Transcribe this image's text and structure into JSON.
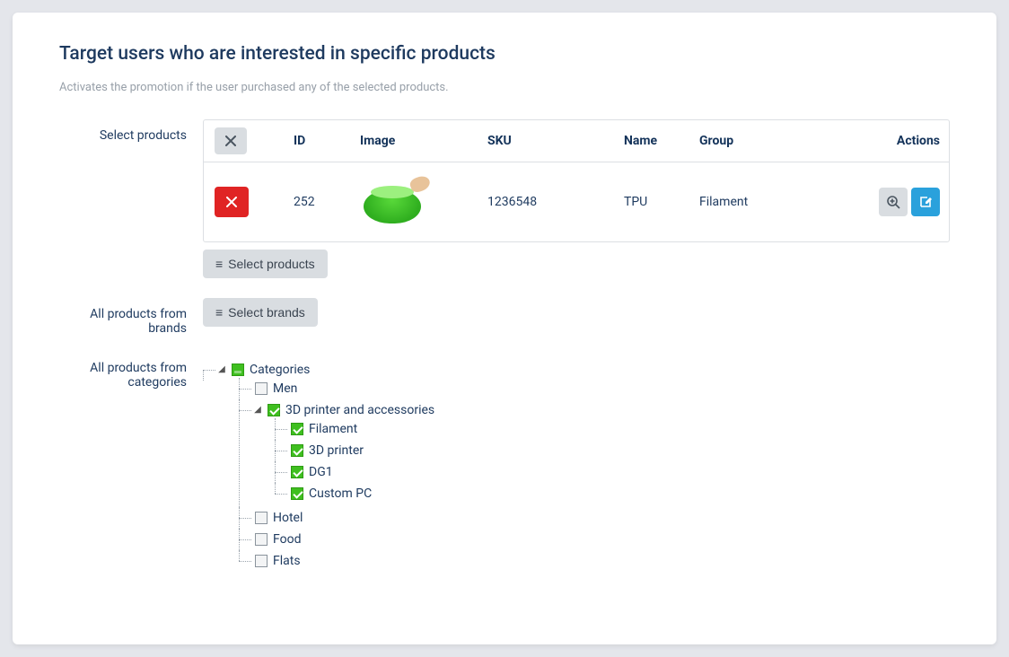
{
  "heading": "Target users who are interested in specific products",
  "subtitle": "Activates the promotion if the user purchased any of the selected products.",
  "labels": {
    "select_products": "Select products",
    "brands": "All products from brands",
    "categories": "All products from categories"
  },
  "table": {
    "headers": {
      "id": "ID",
      "image": "Image",
      "sku": "SKU",
      "name": "Name",
      "group": "Group",
      "actions": "Actions"
    },
    "rows": [
      {
        "id": "252",
        "sku": "1236548",
        "name": "TPU",
        "group": "Filament"
      }
    ]
  },
  "buttons": {
    "select_products": "Select products",
    "select_brands": "Select brands"
  },
  "tree": {
    "root": "Categories",
    "nodes": {
      "men": "Men",
      "printer": "3D printer and accessories",
      "filament": "Filament",
      "printer3d": "3D printer",
      "dg1": "DG1",
      "custompc": "Custom PC",
      "hotel": "Hotel",
      "food": "Food",
      "flats": "Flats"
    }
  }
}
